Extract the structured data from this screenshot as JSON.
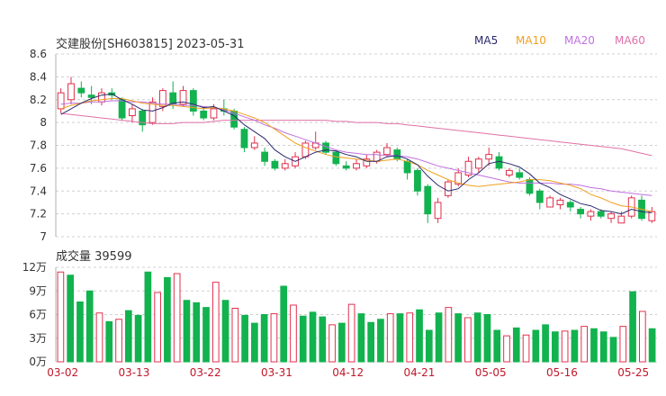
{
  "header": {
    "title": "交建股份[SH603815] 2023-05-31"
  },
  "volume_header": {
    "label": "成交量 39599"
  },
  "legend": [
    {
      "name": "MA5",
      "color": "#2a2a6e"
    },
    {
      "name": "MA10",
      "color": "#f0a020"
    },
    {
      "name": "MA20",
      "color": "#c070e0"
    },
    {
      "name": "MA60",
      "color": "#e070a8"
    }
  ],
  "colors": {
    "up": "#e0304c",
    "down": "#12b24f",
    "grid": "#d0d0d0",
    "axis_text": "#333333",
    "date_text": "#c0182a"
  },
  "chart_data": [
    {
      "type": "candlestick",
      "name": "price",
      "ylim": [
        7.0,
        8.6
      ],
      "yticks": [
        "8.6",
        "8.4",
        "8.2",
        "8",
        "7.8",
        "7.6",
        "7.4",
        "7.2",
        "7"
      ],
      "xticks": [
        "03-02",
        "03-13",
        "03-22",
        "03-31",
        "04-12",
        "04-21",
        "05-05",
        "05-16",
        "05-25"
      ],
      "xtick_index": [
        0,
        7,
        14,
        21,
        28,
        35,
        42,
        49,
        56
      ],
      "candles": [
        [
          8.12,
          8.26,
          8.3,
          8.08
        ],
        [
          8.2,
          8.34,
          8.4,
          8.16
        ],
        [
          8.3,
          8.26,
          8.36,
          8.22
        ],
        [
          8.24,
          8.22,
          8.32,
          8.16
        ],
        [
          8.18,
          8.26,
          8.3,
          8.15
        ],
        [
          8.26,
          8.24,
          8.3,
          8.2
        ],
        [
          8.2,
          8.04,
          8.22,
          8.02
        ],
        [
          8.06,
          8.12,
          8.16,
          8.0
        ],
        [
          8.1,
          7.98,
          8.12,
          7.92
        ],
        [
          8.0,
          8.18,
          8.22,
          7.98
        ],
        [
          8.14,
          8.28,
          8.3,
          8.1
        ],
        [
          8.26,
          8.16,
          8.36,
          8.12
        ],
        [
          8.16,
          8.28,
          8.32,
          8.14
        ],
        [
          8.28,
          8.1,
          8.3,
          8.06
        ],
        [
          8.1,
          8.04,
          8.14,
          8.02
        ],
        [
          8.04,
          8.12,
          8.16,
          8.02
        ],
        [
          8.12,
          8.1,
          8.2,
          8.06
        ],
        [
          8.1,
          7.96,
          8.12,
          7.94
        ],
        [
          7.94,
          7.78,
          7.96,
          7.74
        ],
        [
          7.78,
          7.82,
          7.88,
          7.76
        ],
        [
          7.74,
          7.66,
          7.78,
          7.62
        ],
        [
          7.66,
          7.6,
          7.68,
          7.58
        ],
        [
          7.6,
          7.64,
          7.68,
          7.58
        ],
        [
          7.62,
          7.7,
          7.74,
          7.6
        ],
        [
          7.7,
          7.82,
          7.84,
          7.68
        ],
        [
          7.78,
          7.82,
          7.92,
          7.76
        ],
        [
          7.82,
          7.74,
          7.84,
          7.72
        ],
        [
          7.74,
          7.64,
          7.76,
          7.62
        ],
        [
          7.62,
          7.6,
          7.66,
          7.58
        ],
        [
          7.6,
          7.64,
          7.68,
          7.58
        ],
        [
          7.62,
          7.68,
          7.72,
          7.6
        ],
        [
          7.66,
          7.74,
          7.76,
          7.64
        ],
        [
          7.72,
          7.78,
          7.82,
          7.7
        ],
        [
          7.76,
          7.68,
          7.78,
          7.66
        ],
        [
          7.66,
          7.56,
          7.68,
          7.5
        ],
        [
          7.58,
          7.4,
          7.6,
          7.36
        ],
        [
          7.44,
          7.2,
          7.46,
          7.12
        ],
        [
          7.16,
          7.3,
          7.34,
          7.12
        ],
        [
          7.36,
          7.48,
          7.5,
          7.34
        ],
        [
          7.46,
          7.56,
          7.6,
          7.44
        ],
        [
          7.54,
          7.66,
          7.7,
          7.52
        ],
        [
          7.6,
          7.68,
          7.7,
          7.56
        ],
        [
          7.68,
          7.72,
          7.78,
          7.62
        ],
        [
          7.7,
          7.6,
          7.74,
          7.58
        ],
        [
          7.54,
          7.58,
          7.6,
          7.52
        ],
        [
          7.56,
          7.52,
          7.6,
          7.5
        ],
        [
          7.5,
          7.38,
          7.52,
          7.36
        ],
        [
          7.4,
          7.3,
          7.42,
          7.24
        ],
        [
          7.26,
          7.34,
          7.36,
          7.26
        ],
        [
          7.28,
          7.32,
          7.34,
          7.24
        ],
        [
          7.3,
          7.26,
          7.32,
          7.22
        ],
        [
          7.24,
          7.2,
          7.26,
          7.16
        ],
        [
          7.18,
          7.22,
          7.24,
          7.14
        ],
        [
          7.22,
          7.18,
          7.24,
          7.16
        ],
        [
          7.16,
          7.2,
          7.22,
          7.12
        ],
        [
          7.12,
          7.18,
          7.22,
          7.12
        ],
        [
          7.18,
          7.34,
          7.36,
          7.16
        ],
        [
          7.32,
          7.16,
          7.36,
          7.14
        ],
        [
          7.14,
          7.22,
          7.26,
          7.12
        ]
      ],
      "ma5": [
        8.07,
        8.12,
        8.17,
        8.21,
        8.24,
        8.25,
        8.2,
        8.16,
        8.11,
        8.1,
        8.13,
        8.17,
        8.18,
        8.16,
        8.13,
        8.14,
        8.1,
        8.06,
        7.98,
        7.92,
        7.86,
        7.76,
        7.7,
        7.66,
        7.7,
        7.74,
        7.76,
        7.75,
        7.72,
        7.7,
        7.66,
        7.66,
        7.7,
        7.71,
        7.68,
        7.63,
        7.53,
        7.45,
        7.4,
        7.42,
        7.5,
        7.56,
        7.64,
        7.66,
        7.64,
        7.61,
        7.55,
        7.47,
        7.43,
        7.37,
        7.33,
        7.29,
        7.27,
        7.23,
        7.22,
        7.2,
        7.24,
        7.22,
        7.21
      ],
      "ma10": [
        8.12,
        8.15,
        8.17,
        8.19,
        8.2,
        8.21,
        8.21,
        8.19,
        8.17,
        8.16,
        8.15,
        8.15,
        8.14,
        8.13,
        8.12,
        8.13,
        8.12,
        8.1,
        8.07,
        8.04,
        8.0,
        7.94,
        7.88,
        7.82,
        7.78,
        7.75,
        7.72,
        7.7,
        7.69,
        7.68,
        7.67,
        7.66,
        7.67,
        7.68,
        7.66,
        7.63,
        7.58,
        7.54,
        7.5,
        7.47,
        7.45,
        7.44,
        7.45,
        7.46,
        7.47,
        7.48,
        7.5,
        7.5,
        7.49,
        7.47,
        7.45,
        7.42,
        7.37,
        7.34,
        7.3,
        7.27,
        7.26,
        7.24,
        7.22
      ],
      "ma20": [
        8.16,
        8.17,
        8.17,
        8.18,
        8.18,
        8.19,
        8.19,
        8.18,
        8.18,
        8.17,
        8.16,
        8.16,
        8.15,
        8.15,
        8.14,
        8.13,
        8.11,
        8.08,
        8.05,
        8.02,
        7.98,
        7.95,
        7.91,
        7.88,
        7.85,
        7.82,
        7.79,
        7.76,
        7.74,
        7.73,
        7.72,
        7.72,
        7.71,
        7.71,
        7.7,
        7.68,
        7.65,
        7.62,
        7.6,
        7.58,
        7.56,
        7.54,
        7.52,
        7.5,
        7.48,
        7.47,
        7.47,
        7.47,
        7.47,
        7.46,
        7.46,
        7.45,
        7.43,
        7.42,
        7.4,
        7.39,
        7.38,
        7.37,
        7.36
      ],
      "ma60": [
        8.08,
        8.07,
        8.06,
        8.05,
        8.04,
        8.03,
        8.02,
        8.01,
        8.0,
        7.99,
        7.99,
        7.99,
        8.0,
        8.0,
        8.0,
        8.01,
        8.02,
        8.02,
        8.02,
        8.02,
        8.02,
        8.02,
        8.02,
        8.02,
        8.02,
        8.02,
        8.02,
        8.01,
        8.01,
        8.0,
        8.0,
        8.0,
        7.99,
        7.99,
        7.98,
        7.97,
        7.96,
        7.95,
        7.94,
        7.93,
        7.92,
        7.91,
        7.9,
        7.89,
        7.88,
        7.87,
        7.86,
        7.85,
        7.84,
        7.83,
        7.82,
        7.81,
        7.8,
        7.79,
        7.78,
        7.77,
        7.75,
        7.73,
        7.71
      ]
    },
    {
      "type": "bar",
      "name": "volume",
      "unit": "万",
      "ylim": [
        0,
        12
      ],
      "yticks": [
        "12万",
        "9万",
        "6万",
        "3万",
        "0万"
      ],
      "values": [
        11.4,
        11.0,
        7.6,
        9.0,
        6.2,
        5.1,
        5.4,
        6.5,
        5.9,
        11.4,
        8.8,
        10.7,
        11.2,
        7.8,
        7.5,
        6.9,
        10.1,
        7.8,
        6.8,
        5.9,
        4.9,
        6.0,
        6.1,
        9.6,
        7.2,
        5.8,
        6.3,
        5.7,
        4.7,
        4.9,
        7.3,
        6.1,
        5.0,
        5.4,
        6.1,
        6.1,
        6.2,
        6.6,
        4.0,
        6.2,
        6.9,
        6.1,
        5.6,
        6.2,
        6.0,
        4.0,
        3.3,
        4.3,
        3.4,
        4.0,
        4.7,
        3.8,
        3.9,
        4.0,
        4.5,
        4.2,
        3.8,
        3.1,
        4.5,
        8.9,
        6.4,
        4.2
      ]
    }
  ]
}
